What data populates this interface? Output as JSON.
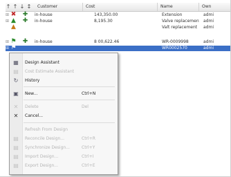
{
  "grid": {
    "columns": [
      {
        "label": "Customer"
      },
      {
        "label": "Cost"
      },
      {
        "label": "Name"
      },
      {
        "label": "Own"
      }
    ],
    "rows": [
      {
        "customer": "in-house",
        "cost": "143,350.00",
        "name": "Extension",
        "owner": "admi",
        "selected": false
      },
      {
        "customer": "in-house",
        "cost": "8,195.30",
        "name": "Valve replacement",
        "owner": "admi",
        "selected": false
      },
      {
        "customer": "",
        "cost": "",
        "name": "Valt replacement",
        "owner": "admi",
        "selected": false
      },
      {
        "customer": "in-house",
        "cost": "8 00,622.46",
        "name": "WR-0009998",
        "owner": "admi",
        "selected": false
      },
      {
        "customer": "",
        "cost": "",
        "name": "WR0002570",
        "owner": "admi",
        "selected": true
      }
    ]
  },
  "context_menu": {
    "items": [
      {
        "label": "Design Assistant",
        "shortcut": "",
        "enabled": true,
        "icon": "design-assistant-icon"
      },
      {
        "label": "Cost Estimate Assistant",
        "shortcut": "",
        "enabled": false,
        "icon": "estimate-icon"
      },
      {
        "label": "History",
        "shortcut": "",
        "enabled": true,
        "icon": "history-icon"
      },
      {
        "label": "New...",
        "shortcut": "Ctrl+N",
        "enabled": true,
        "icon": "new-icon"
      },
      {
        "label": "Delete",
        "shortcut": "Del",
        "enabled": false,
        "icon": "delete-icon"
      },
      {
        "label": "Cancel...",
        "shortcut": "",
        "enabled": true,
        "icon": "cancel-icon"
      },
      {
        "label": "Refresh From Design",
        "shortcut": "",
        "enabled": false,
        "icon": ""
      },
      {
        "label": "Reconcile Design...",
        "shortcut": "Ctrl+R",
        "enabled": false,
        "icon": "reconcile-icon"
      },
      {
        "label": "Synchronize Design...",
        "shortcut": "Ctrl+Y",
        "enabled": false,
        "icon": "synchronize-icon"
      },
      {
        "label": "Import Design...",
        "shortcut": "Ctrl+I",
        "enabled": false,
        "icon": "import-icon"
      },
      {
        "label": "Export Design...",
        "shortcut": "Ctrl+E",
        "enabled": false,
        "icon": "export-icon"
      }
    ]
  },
  "colors": {
    "selection": "#3b6fc6",
    "status_green": "#2a8a2a",
    "status_red": "#c0282a"
  }
}
